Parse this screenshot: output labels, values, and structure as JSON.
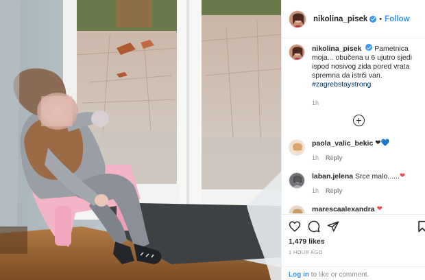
{
  "post": {
    "username": "nikolina_pisek",
    "verified": true,
    "dot": "•",
    "follow_label": "Follow"
  },
  "caption": {
    "username": "nikolina_pisek",
    "text": "Pametnica moja... obučena u 6 ujutro sjedi ispod nosivog zida pored vrata spremna da istrči van.",
    "hashtag": "#zagrebstaystrong",
    "time": "1h"
  },
  "comments": [
    {
      "username": "paola_valic_bekic",
      "text": "❤",
      "emoji2": "💙",
      "time": "1h",
      "reply_label": "Reply"
    },
    {
      "username": "laban.jelena",
      "text": "Srce malo......",
      "emoji2": "❤",
      "time": "1h",
      "reply_label": "Reply"
    },
    {
      "username": "marescaalexandra",
      "text": "",
      "emoji2": "❤",
      "time": "",
      "reply_label": ""
    }
  ],
  "stats": {
    "likes": "1,479 likes",
    "ago": "1 HOUR AGO"
  },
  "login": {
    "link": "Log in",
    "rest": " to like or comment."
  },
  "icons": [
    "heart-icon",
    "comment-icon",
    "share-icon",
    "bookmark-icon",
    "add-comment-icon",
    "verified-badge-icon"
  ],
  "colors": {
    "accent": "#3897f0",
    "like_red": "#ed4956",
    "muted": "#8e8e8e"
  }
}
